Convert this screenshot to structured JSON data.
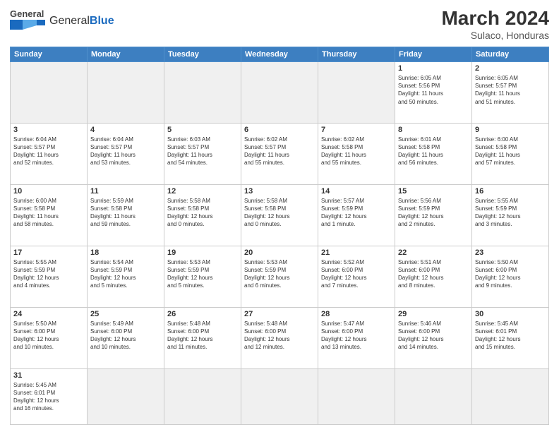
{
  "header": {
    "logo_general": "General",
    "logo_blue": "Blue",
    "title": "March 2024",
    "location": "Sulaco, Honduras"
  },
  "weekdays": [
    "Sunday",
    "Monday",
    "Tuesday",
    "Wednesday",
    "Thursday",
    "Friday",
    "Saturday"
  ],
  "weeks": [
    [
      {
        "day": "",
        "info": ""
      },
      {
        "day": "",
        "info": ""
      },
      {
        "day": "",
        "info": ""
      },
      {
        "day": "",
        "info": ""
      },
      {
        "day": "",
        "info": ""
      },
      {
        "day": "1",
        "info": "Sunrise: 6:05 AM\nSunset: 5:56 PM\nDaylight: 11 hours\nand 50 minutes."
      },
      {
        "day": "2",
        "info": "Sunrise: 6:05 AM\nSunset: 5:57 PM\nDaylight: 11 hours\nand 51 minutes."
      }
    ],
    [
      {
        "day": "3",
        "info": "Sunrise: 6:04 AM\nSunset: 5:57 PM\nDaylight: 11 hours\nand 52 minutes."
      },
      {
        "day": "4",
        "info": "Sunrise: 6:04 AM\nSunset: 5:57 PM\nDaylight: 11 hours\nand 53 minutes."
      },
      {
        "day": "5",
        "info": "Sunrise: 6:03 AM\nSunset: 5:57 PM\nDaylight: 11 hours\nand 54 minutes."
      },
      {
        "day": "6",
        "info": "Sunrise: 6:02 AM\nSunset: 5:57 PM\nDaylight: 11 hours\nand 55 minutes."
      },
      {
        "day": "7",
        "info": "Sunrise: 6:02 AM\nSunset: 5:58 PM\nDaylight: 11 hours\nand 55 minutes."
      },
      {
        "day": "8",
        "info": "Sunrise: 6:01 AM\nSunset: 5:58 PM\nDaylight: 11 hours\nand 56 minutes."
      },
      {
        "day": "9",
        "info": "Sunrise: 6:00 AM\nSunset: 5:58 PM\nDaylight: 11 hours\nand 57 minutes."
      }
    ],
    [
      {
        "day": "10",
        "info": "Sunrise: 6:00 AM\nSunset: 5:58 PM\nDaylight: 11 hours\nand 58 minutes."
      },
      {
        "day": "11",
        "info": "Sunrise: 5:59 AM\nSunset: 5:58 PM\nDaylight: 11 hours\nand 59 minutes."
      },
      {
        "day": "12",
        "info": "Sunrise: 5:58 AM\nSunset: 5:58 PM\nDaylight: 12 hours\nand 0 minutes."
      },
      {
        "day": "13",
        "info": "Sunrise: 5:58 AM\nSunset: 5:58 PM\nDaylight: 12 hours\nand 0 minutes."
      },
      {
        "day": "14",
        "info": "Sunrise: 5:57 AM\nSunset: 5:59 PM\nDaylight: 12 hours\nand 1 minute."
      },
      {
        "day": "15",
        "info": "Sunrise: 5:56 AM\nSunset: 5:59 PM\nDaylight: 12 hours\nand 2 minutes."
      },
      {
        "day": "16",
        "info": "Sunrise: 5:55 AM\nSunset: 5:59 PM\nDaylight: 12 hours\nand 3 minutes."
      }
    ],
    [
      {
        "day": "17",
        "info": "Sunrise: 5:55 AM\nSunset: 5:59 PM\nDaylight: 12 hours\nand 4 minutes."
      },
      {
        "day": "18",
        "info": "Sunrise: 5:54 AM\nSunset: 5:59 PM\nDaylight: 12 hours\nand 5 minutes."
      },
      {
        "day": "19",
        "info": "Sunrise: 5:53 AM\nSunset: 5:59 PM\nDaylight: 12 hours\nand 5 minutes."
      },
      {
        "day": "20",
        "info": "Sunrise: 5:53 AM\nSunset: 5:59 PM\nDaylight: 12 hours\nand 6 minutes."
      },
      {
        "day": "21",
        "info": "Sunrise: 5:52 AM\nSunset: 6:00 PM\nDaylight: 12 hours\nand 7 minutes."
      },
      {
        "day": "22",
        "info": "Sunrise: 5:51 AM\nSunset: 6:00 PM\nDaylight: 12 hours\nand 8 minutes."
      },
      {
        "day": "23",
        "info": "Sunrise: 5:50 AM\nSunset: 6:00 PM\nDaylight: 12 hours\nand 9 minutes."
      }
    ],
    [
      {
        "day": "24",
        "info": "Sunrise: 5:50 AM\nSunset: 6:00 PM\nDaylight: 12 hours\nand 10 minutes."
      },
      {
        "day": "25",
        "info": "Sunrise: 5:49 AM\nSunset: 6:00 PM\nDaylight: 12 hours\nand 10 minutes."
      },
      {
        "day": "26",
        "info": "Sunrise: 5:48 AM\nSunset: 6:00 PM\nDaylight: 12 hours\nand 11 minutes."
      },
      {
        "day": "27",
        "info": "Sunrise: 5:48 AM\nSunset: 6:00 PM\nDaylight: 12 hours\nand 12 minutes."
      },
      {
        "day": "28",
        "info": "Sunrise: 5:47 AM\nSunset: 6:00 PM\nDaylight: 12 hours\nand 13 minutes."
      },
      {
        "day": "29",
        "info": "Sunrise: 5:46 AM\nSunset: 6:00 PM\nDaylight: 12 hours\nand 14 minutes."
      },
      {
        "day": "30",
        "info": "Sunrise: 5:45 AM\nSunset: 6:01 PM\nDaylight: 12 hours\nand 15 minutes."
      }
    ],
    [
      {
        "day": "31",
        "info": "Sunrise: 5:45 AM\nSunset: 6:01 PM\nDaylight: 12 hours\nand 16 minutes."
      },
      {
        "day": "",
        "info": ""
      },
      {
        "day": "",
        "info": ""
      },
      {
        "day": "",
        "info": ""
      },
      {
        "day": "",
        "info": ""
      },
      {
        "day": "",
        "info": ""
      },
      {
        "day": "",
        "info": ""
      }
    ]
  ]
}
